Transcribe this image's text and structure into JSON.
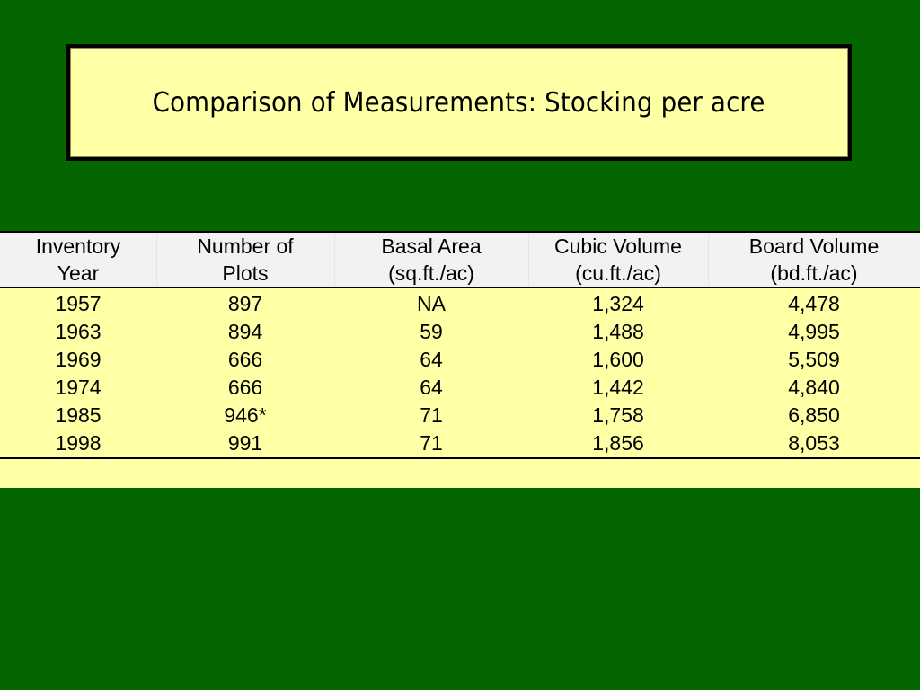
{
  "title": "Comparison of Measurements: Stocking per acre",
  "table": {
    "headers": [
      [
        "Inventory",
        "Year"
      ],
      [
        "Number of",
        "Plots"
      ],
      [
        "Basal Area",
        "(sq.ft./ac)"
      ],
      [
        "Cubic Volume",
        "(cu.ft./ac)"
      ],
      [
        "Board Volume",
        "(bd.ft./ac)"
      ]
    ],
    "rows": [
      [
        "1957",
        "897",
        "NA",
        "1,324",
        "4,478"
      ],
      [
        "1963",
        "894",
        "59",
        "1,488",
        "4,995"
      ],
      [
        "1969",
        "666",
        "64",
        "1,600",
        "5,509"
      ],
      [
        "1974",
        "666",
        "64",
        "1,442",
        "4,840"
      ],
      [
        "1985",
        "946*",
        "71",
        "1,758",
        "6,850"
      ],
      [
        "1998",
        "991",
        "71",
        "1,856",
        "8,053"
      ]
    ]
  },
  "colors": {
    "background": "#036600",
    "title_fill": "#ffffa6",
    "table_fill": "#ffffa6",
    "header_fill": "#f2f2f2"
  }
}
